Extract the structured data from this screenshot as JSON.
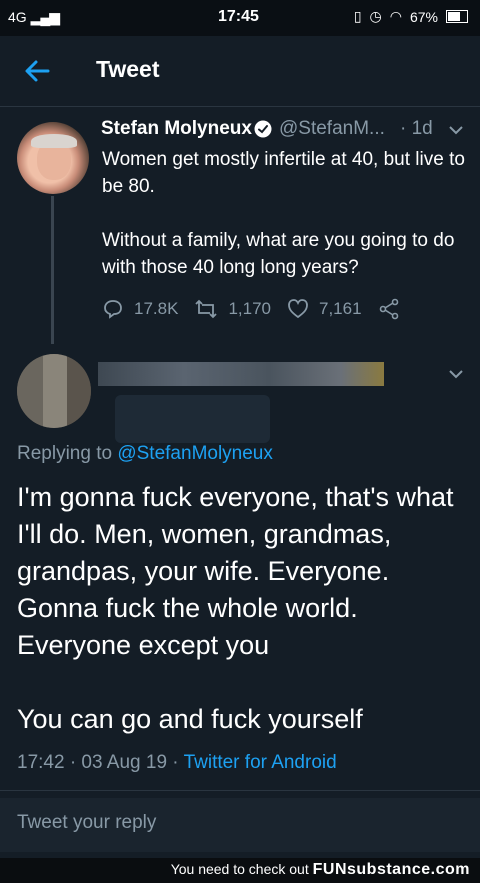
{
  "status_bar": {
    "network": "4G",
    "time": "17:45",
    "battery": "67%"
  },
  "header": {
    "title": "Tweet"
  },
  "tweet": {
    "author_name": "Stefan Molyneux",
    "handle": "@StefanM...",
    "age": "· 1d",
    "paragraphs": [
      "Women get mostly infertile at 40, but live to be 80.",
      "Without a family, what are you going to do with those 40 long long years?"
    ],
    "replies": "17.8K",
    "retweets": "1,170",
    "likes": "7,161"
  },
  "reply": {
    "replying_prefix": "Replying to",
    "replying_to": "@StefanMolyneux",
    "paragraphs": [
      "I'm gonna fuck everyone, that's what I'll do. Men, women, grandmas, grandpas, your wife. Everyone. Gonna fuck the whole world. Everyone except you",
      "You can go and fuck yourself"
    ],
    "timestamp": "17:42 · 03 Aug 19 · ",
    "source": "Twitter for Android"
  },
  "compose": {
    "placeholder": "Tweet your reply"
  },
  "footer": {
    "text": "You need to check out",
    "brand": "FUNsubstance.com"
  },
  "colors": {
    "background": "#141d26",
    "accent": "#1da1f2",
    "muted": "#8899a6"
  },
  "icons": [
    "back-arrow-icon",
    "verified-badge-icon",
    "chevron-down-icon",
    "reply-icon",
    "retweet-icon",
    "like-icon",
    "share-icon"
  ]
}
